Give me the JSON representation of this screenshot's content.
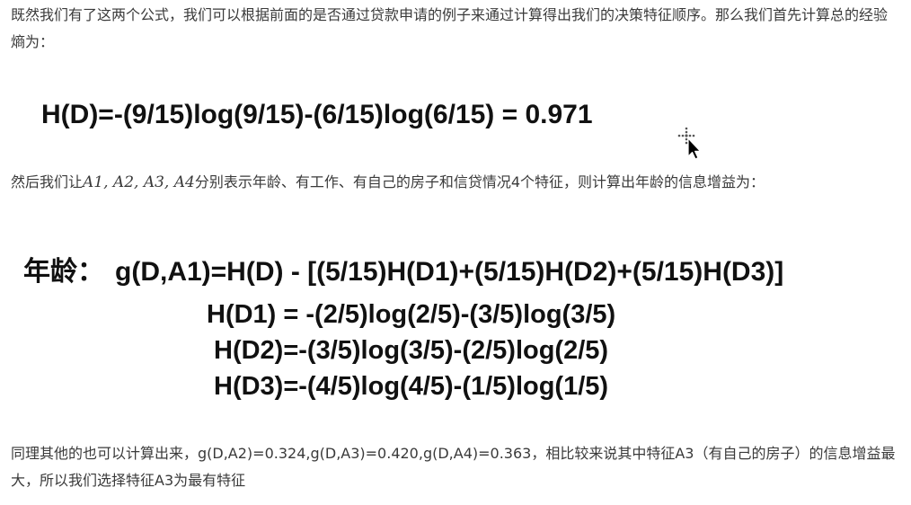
{
  "paragraphs": {
    "intro": "既然我们有了这两个公式，我们可以根据前面的是否通过贷款申请的例子来通过计算得出我们的决策特征顺序。那么我们首先计算总的经验熵为：",
    "features_before": "然后我们让",
    "features_math": "A1, A2, A3, A4",
    "features_after": "分别表示年龄、有工作、有自己的房子和信贷情况4个特征，则计算出年龄的信息增益为：",
    "conclusion": "同理其他的也可以计算出来，g(D,A2)=0.324,g(D,A3)=0.420,g(D,A4)=0.363，相比较来说其中特征A3（有自己的房子）的信息增益最大，所以我们选择特征A3为最有特征"
  },
  "formulas": {
    "entropy": "H(D)=-(9/15)log(9/15)-(6/15)log(6/15) = 0.971",
    "gain_label": "年龄：",
    "gain": "g(D,A1)=H(D) - [(5/15)H(D1)+(5/15)H(D2)+(5/15)H(D3)]",
    "hd1": "H(D1) = -(2/5)log(2/5)-(3/5)log(3/5)",
    "hd2": "H(D2)=-(3/5)log(3/5)-(2/5)log(2/5)",
    "hd3": "H(D3)=-(4/5)log(4/5)-(1/5)log(1/5)"
  },
  "icons": {
    "cursor": "move-cursor-icon"
  },
  "colors": {
    "body_text": "#3a3a3a",
    "formula_text": "#111111",
    "background": "#ffffff"
  }
}
